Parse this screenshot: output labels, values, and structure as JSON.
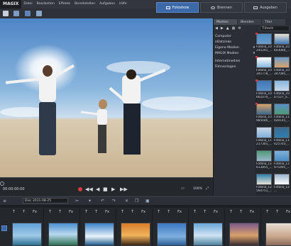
{
  "app": {
    "logo": "MAGIX"
  },
  "menu": [
    "Datei",
    "Bearbeiten",
    "Effekte",
    "Bereitstellen",
    "Aufgaben",
    "Hilfe"
  ],
  "modes": [
    {
      "label": "Fotoshow",
      "active": true
    },
    {
      "label": "Brennen",
      "active": false
    },
    {
      "label": "Ausgeben",
      "active": false
    }
  ],
  "preview": {
    "timecode": "00:00:00:00",
    "zoom": "100%"
  },
  "panel": {
    "tabs": [
      "Medien",
      "Blenden",
      "Titel"
    ],
    "path": "T:\\hech",
    "tree": [
      "Computer",
      "eDatzinke",
      "Eigene Medien",
      "MAGIX Medien",
      "Internetmedien",
      "Filmvorlagen"
    ],
    "thumbs": [
      {
        "label": "Fotolia_10",
        "sub": "245291_..."
      },
      {
        "label": "Fotolia_10",
        "sub": "603060_..."
      },
      {
        "label": "Fotolia_10",
        "sub": "341778_..."
      },
      {
        "label": "Fotolia_10",
        "sub": "347085_..."
      },
      {
        "label": "Fotolia_10",
        "sub": "661070_..."
      },
      {
        "label": "Fotolia_10",
        "sub": "47527_S..."
      },
      {
        "label": "Fotolia_10",
        "sub": "985046_..."
      },
      {
        "label": "Fotolia_11",
        "sub": "020145_..."
      },
      {
        "label": "Fotolia_11",
        "sub": "217301_..."
      },
      {
        "label": "Fotolia_11",
        "sub": "425703_..."
      },
      {
        "label": "Fotolia_11",
        "sub": "613855_..."
      },
      {
        "label": "Fotolia_11",
        "sub": "975491_..."
      },
      {
        "label": "Fotolia_12",
        "sub": "564751_..."
      },
      {
        "label": "Fotolia_12",
        "sub": "..."
      }
    ]
  },
  "timeline": {
    "disc": "Disc 2011-08-25",
    "clip_tools": [
      "T",
      "T",
      "Fx"
    ]
  },
  "colors": {
    "accent": "#3c6aa8",
    "record": "#d23c3c"
  }
}
